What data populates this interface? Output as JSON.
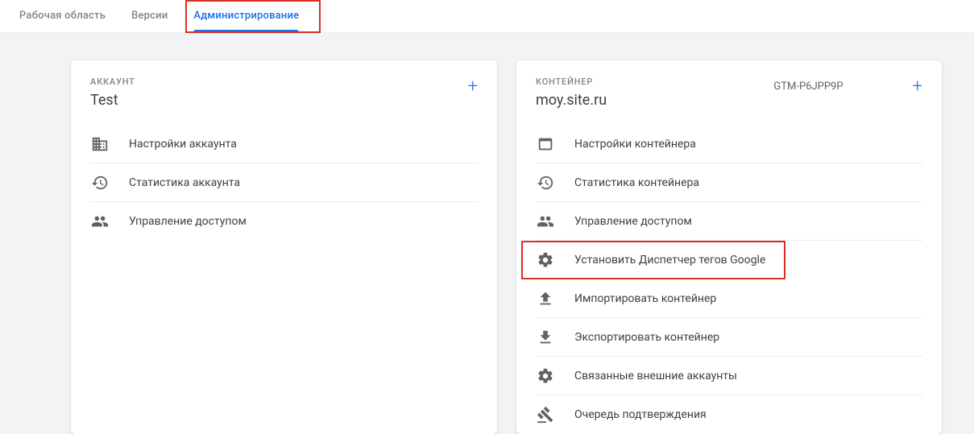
{
  "tabs": {
    "workspace": "Рабочая область",
    "versions": "Версии",
    "admin": "Администрирование"
  },
  "account": {
    "section_label": "АККАУНТ",
    "name": "Test",
    "items": [
      {
        "label": "Настройки аккаунта"
      },
      {
        "label": "Статистика аккаунта"
      },
      {
        "label": "Управление доступом"
      }
    ]
  },
  "container": {
    "section_label": "КОНТЕЙНЕР",
    "name": "moy.site.ru",
    "id": "GTM-P6JPP9P",
    "items": [
      {
        "label": "Настройки контейнера"
      },
      {
        "label": "Статистика контейнера"
      },
      {
        "label": "Управление доступом"
      },
      {
        "label": "Установить Диспетчер тегов Google"
      },
      {
        "label": "Импортировать контейнер"
      },
      {
        "label": "Экспортировать контейнер"
      },
      {
        "label": "Связанные внешние аккаунты"
      },
      {
        "label": "Очередь подтверждения"
      }
    ]
  }
}
